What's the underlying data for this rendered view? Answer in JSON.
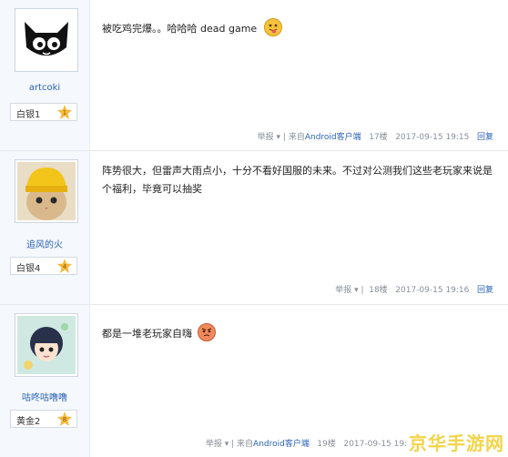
{
  "posts": [
    {
      "username": "artcoki",
      "level": "白银1",
      "level_badge": "1",
      "content_lines": [
        "被吃鸡完爆。。哈哈哈 dead game"
      ],
      "emoji": "tongue-face-emoji",
      "report": "举报",
      "source_prefix": "来自",
      "source": "Android客户端",
      "floor": "17楼",
      "time": "2017-09-15 19:15",
      "reply": "回复"
    },
    {
      "username": "追风的火",
      "level": "白银4",
      "level_badge": "4",
      "content_lines": [
        "阵势很大，但雷声大雨点小，十分不看好国服的未来。不过对公测我们这些老玩家来说是",
        "个福利，毕竟可以抽奖"
      ],
      "report": "举报",
      "source_prefix": "",
      "source": "",
      "floor": "18楼",
      "time": "2017-09-15 19:16",
      "reply": "回复"
    },
    {
      "username": "咕咚咕噜噜",
      "level": "黄金2",
      "level_badge": "8",
      "content_lines": [
        "都是一堆老玩家自嗨"
      ],
      "emoji": "angry-face-emoji",
      "report": "举报",
      "source_prefix": "来自",
      "source": "Android客户端",
      "floor": "19楼",
      "time": "2017-09-15 19:",
      "reply": ""
    }
  ],
  "watermark": "京华手游网",
  "colors": {
    "link": "#2a62b6",
    "sidebar": "#f5f8fc",
    "watermark": "#f2d44a"
  }
}
